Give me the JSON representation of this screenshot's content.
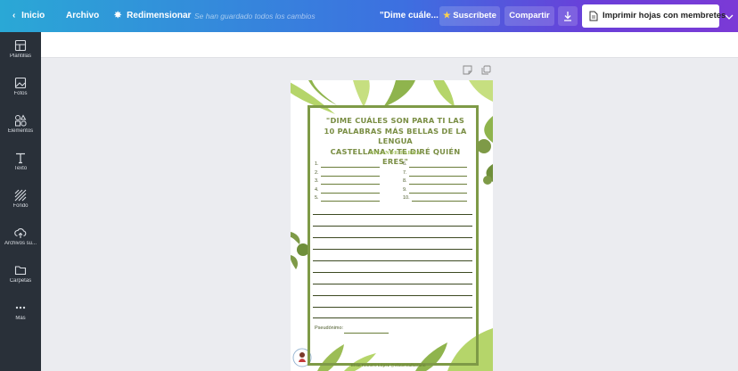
{
  "topbar": {
    "home_label": "Inicio",
    "file_label": "Archivo",
    "resize_label": "Redimensionar",
    "save_status": "Se han guardado todos los cambios",
    "doc_title": "\"Dime cuále...",
    "subscribe_label": "Suscríbete",
    "share_label": "Compartir",
    "print_label": "Imprimir hojas con membretes"
  },
  "sidebar": {
    "items": [
      {
        "label": "Plantillas",
        "icon": "templates-icon"
      },
      {
        "label": "Fotos",
        "icon": "photos-icon"
      },
      {
        "label": "Elementos",
        "icon": "elements-icon"
      },
      {
        "label": "Texto",
        "icon": "text-icon"
      },
      {
        "label": "Fondo",
        "icon": "background-icon"
      },
      {
        "label": "Archivos su...",
        "icon": "upload-icon"
      },
      {
        "label": "Carpetas",
        "icon": "folder-icon"
      },
      {
        "label": "Más",
        "icon": "more-icon"
      }
    ]
  },
  "worksheet": {
    "title_lines": [
      "\"DIME CUÁLES SON PARA TI LAS",
      "10 PALABRAS MÁS BELLAS DE LA LENGUA",
      "CASTELLANA Y TE DIRÉ QUIÉN ERES\""
    ],
    "author": "NICANOR PARRA",
    "numbers_left": [
      "1.",
      "2.",
      "3.",
      "4.",
      "5."
    ],
    "numbers_right": [
      "6.",
      "7.",
      "8.",
      "9.",
      "10."
    ],
    "pseudonym_label": "Pseudónimo:",
    "footer_credit": "Elsia Romero López @elbuentalbarario"
  },
  "colors": {
    "accent_green": "#7e9a47",
    "leaf_light": "#b5d56a",
    "leaf_dark": "#6f8f3a",
    "sidebar_bg": "#293039"
  }
}
